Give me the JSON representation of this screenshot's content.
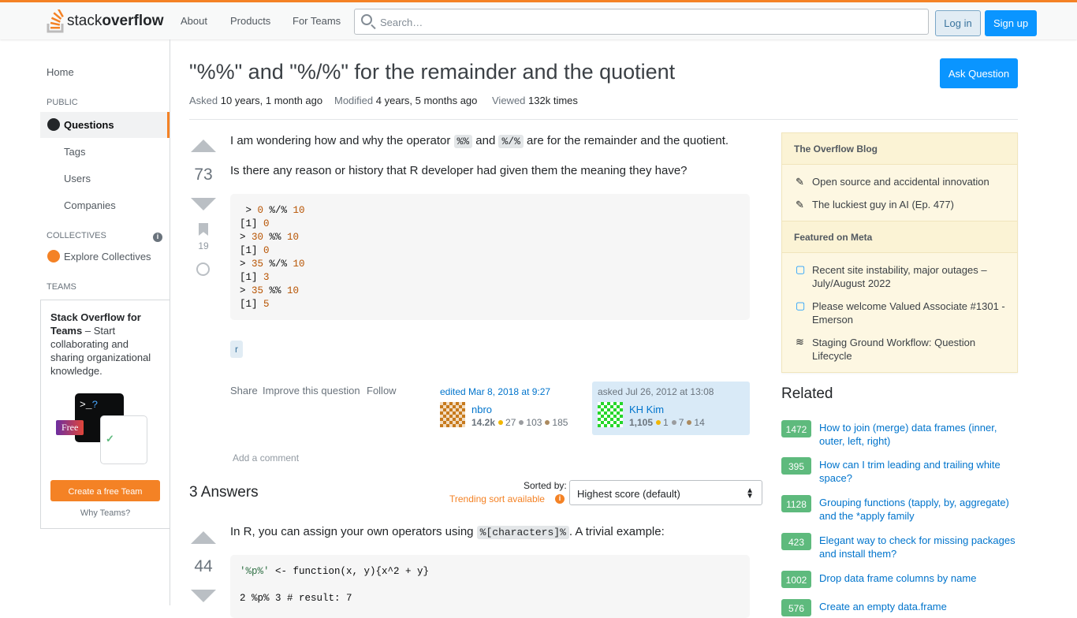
{
  "header": {
    "logo_text_a": "stack",
    "logo_text_b": "overflow",
    "nav": [
      "About",
      "Products",
      "For Teams"
    ],
    "search_placeholder": "Search…",
    "login": "Log in",
    "signup": "Sign up"
  },
  "left_nav": {
    "home": "Home",
    "public": "PUBLIC",
    "questions": "Questions",
    "tags": "Tags",
    "users": "Users",
    "companies": "Companies",
    "collectives": "COLLECTIVES",
    "explore": "Explore Collectives",
    "teams": "TEAMS",
    "teams_title": "Stack Overflow for Teams",
    "teams_desc": " – Start collaborating and sharing organizational knowledge.",
    "free_badge": "Free",
    "create_team": "Create a free Team",
    "why_teams": "Why Teams?"
  },
  "question": {
    "title": "\"%%\" and \"%/%\" for the remainder and the quotient",
    "asked_label": "Asked",
    "asked": "10 years, 1 month ago",
    "modified_label": "Modified",
    "modified": "4 years, 5 months ago",
    "viewed_label": "Viewed",
    "viewed": "132k times",
    "ask_button": "Ask Question",
    "score": "73",
    "bookmarks": "19",
    "p1_a": "I am wondering how and why the operator ",
    "code1": "%%",
    "p1_b": " and ",
    "code2": "%/%",
    "p1_c": " are for the remainder and the quotient.",
    "p2": "Is there any reason or history that R developer had given them the meaning they have?",
    "code_lines": [
      " > 0 %/% 10",
      "[1] 0",
      "> 30 %% 10",
      "[1] 0",
      "> 35 %/% 10",
      "[1] 3",
      "> 35 %% 10",
      "[1] 5"
    ],
    "tag": "r",
    "share": "Share",
    "improve": "Improve this question",
    "follow": "Follow",
    "edited": "edited Mar 8, 2018 at 9:27",
    "editor": {
      "name": "nbro",
      "rep": "14.2k",
      "gold": "27",
      "silver": "103",
      "bronze": "185"
    },
    "asked_card": "asked Jul 26, 2012 at 13:08",
    "author": {
      "name": "KH Kim",
      "rep": "1,105",
      "gold": "1",
      "silver": "7",
      "bronze": "14"
    },
    "add_comment": "Add a comment"
  },
  "answers": {
    "count": "3 Answers",
    "sorted_by": "Sorted by:",
    "trending": "Trending sort available",
    "sort_value": "Highest score (default)",
    "first": {
      "score": "44",
      "p_a": "In R, you can assign your own operators using ",
      "code": "%[characters]%",
      "p_b": ". A trivial example:",
      "line1_str": "'%p%'",
      "line1_rest": " <- function(x, y){x^2 + y}",
      "line2": "2 %p% 3 # result: 7"
    }
  },
  "blog": {
    "title": "The Overflow Blog",
    "items": [
      "Open source and accidental innovation",
      "The luckiest guy in AI (Ep. 477)"
    ],
    "meta_title": "Featured on Meta",
    "meta_items": [
      "Recent site instability, major outages – July/August 2022",
      "Please welcome Valued Associate #1301 - Emerson",
      "Staging Ground Workflow: Question Lifecycle"
    ]
  },
  "related": {
    "title": "Related",
    "items": [
      {
        "score": "1472",
        "title": "How to join (merge) data frames (inner, outer, left, right)"
      },
      {
        "score": "395",
        "title": "How can I trim leading and trailing white space?"
      },
      {
        "score": "1128",
        "title": "Grouping functions (tapply, by, aggregate) and the *apply family"
      },
      {
        "score": "423",
        "title": "Elegant way to check for missing packages and install them?"
      },
      {
        "score": "1002",
        "title": "Drop data frame columns by name"
      },
      {
        "score": "576",
        "title": "Create an empty data.frame"
      }
    ]
  },
  "colors": {
    "accent": "#f48225",
    "primary": "#0a95ff",
    "related_score": "#5eba7d"
  }
}
